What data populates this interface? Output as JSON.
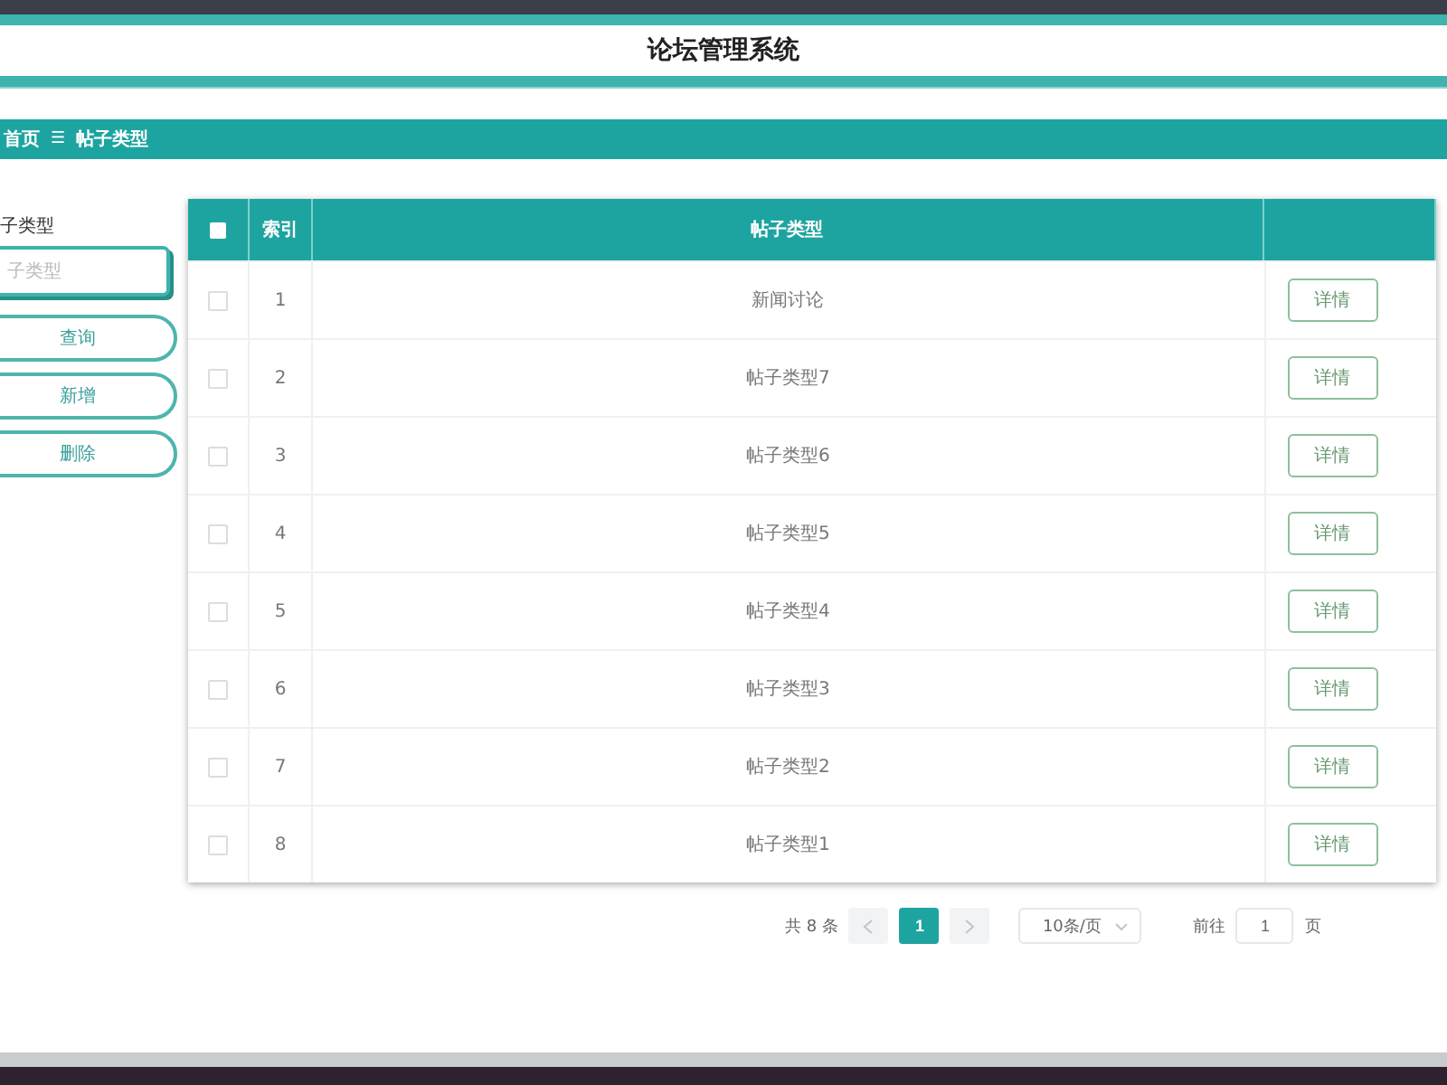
{
  "header": {
    "title": "论坛管理系统"
  },
  "breadcrumb": {
    "items": [
      "首页",
      "帖子类型"
    ],
    "separator": "☰"
  },
  "search": {
    "label": "子类型",
    "placeholder": "子类型"
  },
  "buttons": [
    "查询",
    "新增",
    "删除"
  ],
  "table": {
    "all_checked": false,
    "columns": [
      "索引",
      "帖子类型"
    ],
    "rows": [
      {
        "index": "1",
        "type": "新闻讨论",
        "checked": false,
        "action": "详情"
      },
      {
        "index": "2",
        "type": "帖子类型7",
        "checked": false,
        "action": "详情"
      },
      {
        "index": "3",
        "type": "帖子类型6",
        "checked": false,
        "action": "详情"
      },
      {
        "index": "4",
        "type": "帖子类型5",
        "checked": false,
        "action": "详情"
      },
      {
        "index": "5",
        "type": "帖子类型4",
        "checked": false,
        "action": "详情"
      },
      {
        "index": "6",
        "type": "帖子类型3",
        "checked": false,
        "action": "详情"
      },
      {
        "index": "7",
        "type": "帖子类型2",
        "checked": false,
        "action": "详情"
      },
      {
        "index": "8",
        "type": "帖子类型1",
        "checked": false,
        "action": "详情"
      }
    ]
  },
  "pagination": {
    "total": "共 8 条",
    "pages": [
      {
        "label": "1",
        "selected": true
      }
    ],
    "page_size": "10条/页",
    "goto_label": "前往",
    "goto_value": "1",
    "goto_suffix": "页"
  }
}
